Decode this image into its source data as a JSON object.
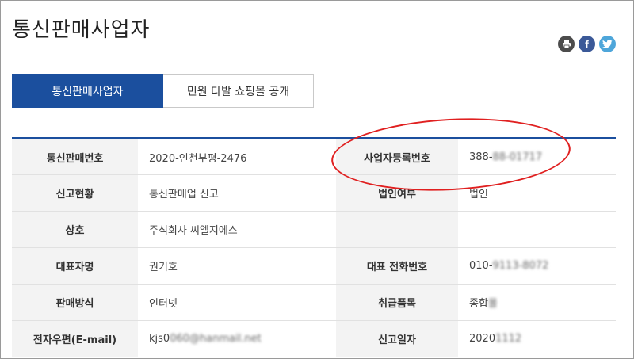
{
  "page": {
    "title": "통신판매사업자"
  },
  "share": {
    "print_icon": "printer-icon",
    "facebook_label": "f",
    "twitter_icon": "twitter-bird-icon"
  },
  "tabs": [
    {
      "label": "통신판매사업자",
      "active": true
    },
    {
      "label": "민원 다발 쇼핑몰 공개",
      "active": false
    }
  ],
  "colors": {
    "accent": "#1b4f9e",
    "highlight": "#e02020",
    "header_bg": "#f3f3f3"
  },
  "table": {
    "rows": [
      {
        "label1": "통신판매번호",
        "value1": "2020-인천부평-2476",
        "label2": "사업자등록번호",
        "value2_visible": "388-",
        "value2_blurred": "88-01717"
      },
      {
        "label1": "신고현황",
        "value1": "통신판매업 신고",
        "label2": "법인여부",
        "value2_visible": "법인",
        "value2_blurred": ""
      },
      {
        "label1": "상호",
        "value1": "주식회사 씨엘지에스",
        "label2": "",
        "value2_visible": "",
        "value2_blurred": ""
      },
      {
        "label1": "대표자명",
        "value1": "권기호",
        "label2": "대표 전화번호",
        "value2_visible": "010-",
        "value2_blurred": "9113-8072"
      },
      {
        "label1": "판매방식",
        "value1": "인터넷",
        "label2": "취급품목",
        "value2_visible": "종합",
        "value2_blurred": "몰"
      },
      {
        "label1": "전자우편(E-mail)",
        "value1_visible": "kjs0",
        "value1_blurred": "060@hanmail.net",
        "label2": "신고일자",
        "value2_visible": "2020",
        "value2_blurred": "1112"
      }
    ]
  }
}
